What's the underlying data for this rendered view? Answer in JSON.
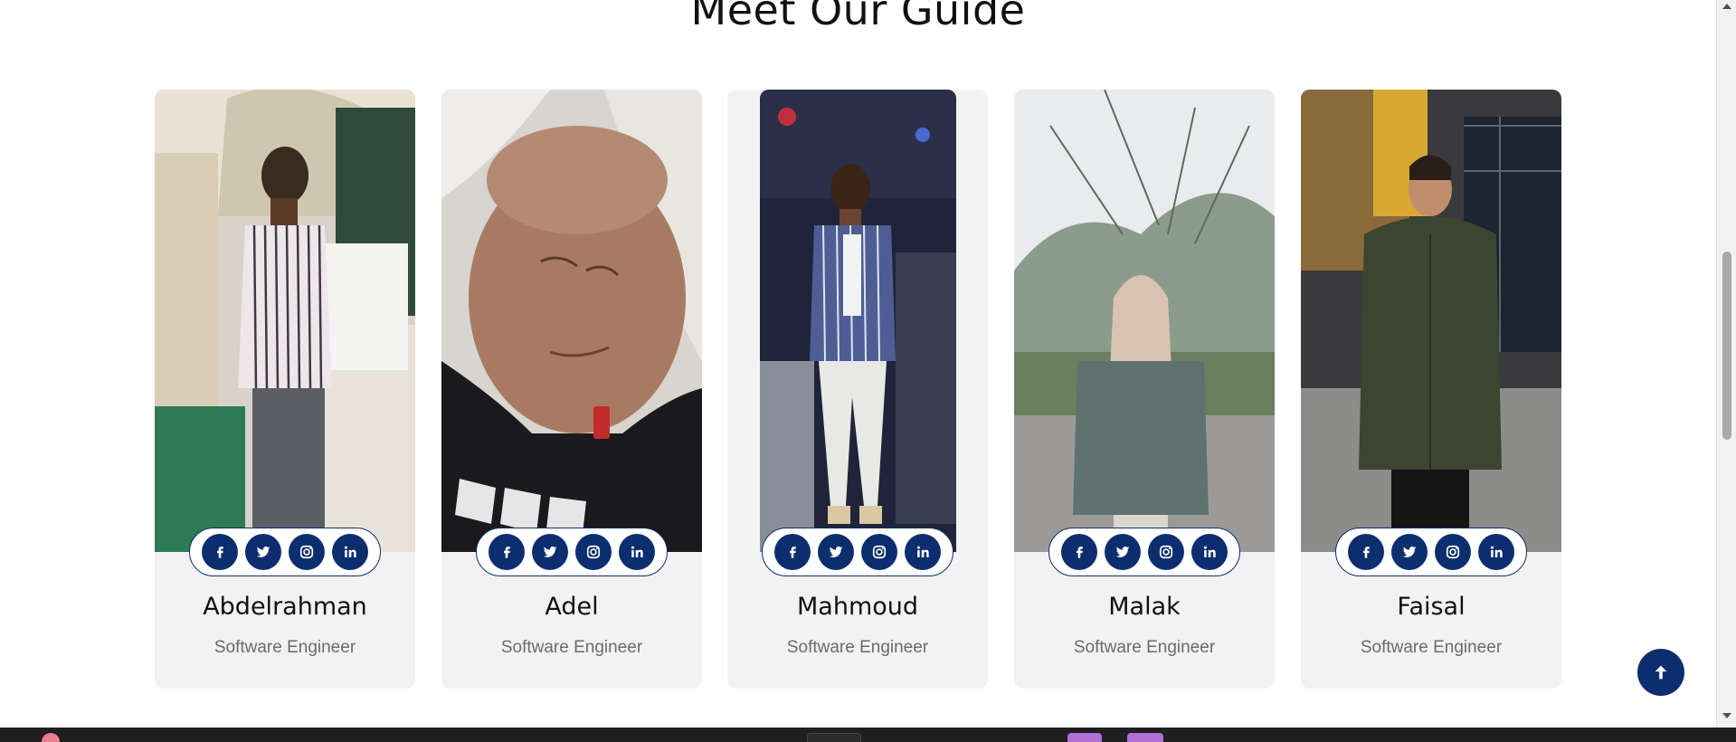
{
  "section": {
    "title": "Meet Our Guide"
  },
  "team": [
    {
      "name": "Abdelrahman",
      "role": "Software Engineer"
    },
    {
      "name": "Adel",
      "role": "Software Engineer"
    },
    {
      "name": "Mahmoud",
      "role": "Software Engineer"
    },
    {
      "name": "Malak",
      "role": "Software Engineer"
    },
    {
      "name": "Faisal",
      "role": "Software Engineer"
    }
  ],
  "social_icons": [
    "facebook-icon",
    "twitter-icon",
    "instagram-icon",
    "linkedin-icon"
  ],
  "colors": {
    "accent": "#0d2e6e",
    "card_background": "#f2f2f2",
    "name_text": "#111111",
    "role_text": "#6b6b6b"
  },
  "scroll_top_icon": "arrow-up-icon"
}
